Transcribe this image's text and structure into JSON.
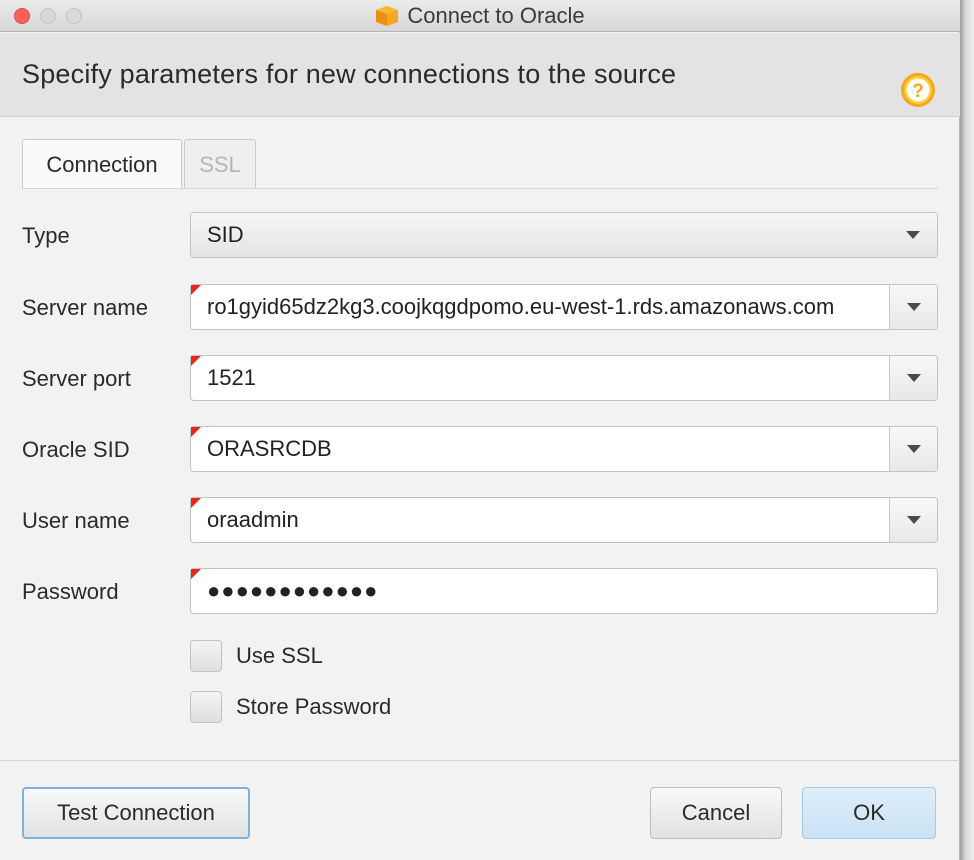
{
  "window": {
    "title": "Connect to Oracle",
    "icon": "aws-box-icon"
  },
  "header": {
    "text": "Specify parameters for new connections to the source",
    "help_icon": "help-icon",
    "accent_color": "#f5a623"
  },
  "tabs": [
    {
      "label": "Connection",
      "active": true
    },
    {
      "label": "SSL",
      "active": false
    }
  ],
  "form": {
    "type": {
      "label": "Type",
      "value": "SID"
    },
    "server_name": {
      "label": "Server name",
      "value": "ro1gyid65dz2kg3.coojkqgdpomo.eu-west-1.rds.amazonaws.com"
    },
    "server_port": {
      "label": "Server port",
      "value": "1521"
    },
    "oracle_sid": {
      "label": "Oracle SID",
      "value": "ORASRCDB"
    },
    "user_name": {
      "label": "User name",
      "value": "oraadmin"
    },
    "password": {
      "label": "Password",
      "value": "●●●●●●●●●●●●"
    },
    "use_ssl": {
      "label": "Use SSL",
      "checked": false
    },
    "store_password": {
      "label": "Store Password",
      "checked": false
    }
  },
  "footer": {
    "test_connection": "Test Connection",
    "cancel": "Cancel",
    "ok": "OK"
  }
}
